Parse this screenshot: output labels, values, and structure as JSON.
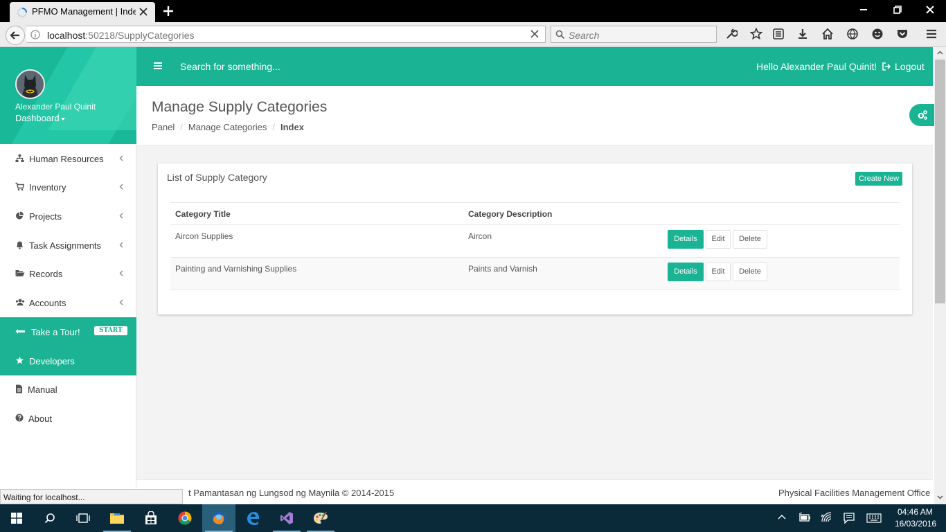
{
  "browser": {
    "tab_title": "PFMO Management | Index",
    "url_host": "localhost",
    "url_rest": ":50218/SupplyCategories",
    "search_placeholder": "Search",
    "status_text": "Waiting for localhost..."
  },
  "sidebar": {
    "user_name": "Alexander Paul Quinit",
    "dashboard_label": "Dashboard",
    "items": [
      {
        "label": "Human Resources",
        "icon": "sitemap-icon"
      },
      {
        "label": "Inventory",
        "icon": "cart-icon"
      },
      {
        "label": "Projects",
        "icon": "pie-chart-icon"
      },
      {
        "label": "Task Assignments",
        "icon": "bell-icon"
      },
      {
        "label": "Records",
        "icon": "folder-open-icon"
      },
      {
        "label": "Accounts",
        "icon": "users-icon"
      },
      {
        "label": "Take a Tour!",
        "icon": "signpost-icon",
        "badge": "START"
      },
      {
        "label": "Developers",
        "icon": "star-icon"
      },
      {
        "label": "Manual",
        "icon": "file-icon"
      },
      {
        "label": "About",
        "icon": "question-circle-icon"
      }
    ]
  },
  "topbar": {
    "search_placeholder": "Search for something...",
    "greeting": "Hello Alexander Paul Quinit!",
    "logout_label": "Logout"
  },
  "page": {
    "title": "Manage Supply Categories",
    "breadcrumb": [
      "Panel",
      "Manage Categories",
      "Index"
    ]
  },
  "panel": {
    "title": "List of Supply Category",
    "create_label": "Create New",
    "columns": [
      "Category Title",
      "Category Description"
    ],
    "rows": [
      {
        "title": "Aircon Supplies",
        "description": "Aircon"
      },
      {
        "title": "Painting and Varnishing Supplies",
        "description": "Paints and Varnish"
      }
    ],
    "details_label": "Details",
    "edit_label": "Edit",
    "delete_label": "Delete"
  },
  "footer": {
    "left": "t Pamantasan ng Lungsod ng Maynila © 2014-2015",
    "right": "Physical Facilities Management Office"
  },
  "taskbar": {
    "time": "04:46 AM",
    "date": "16/03/2016"
  },
  "colors": {
    "accent": "#1ab394",
    "titlebar": "#000000",
    "taskbar": "#0a2a3a"
  }
}
